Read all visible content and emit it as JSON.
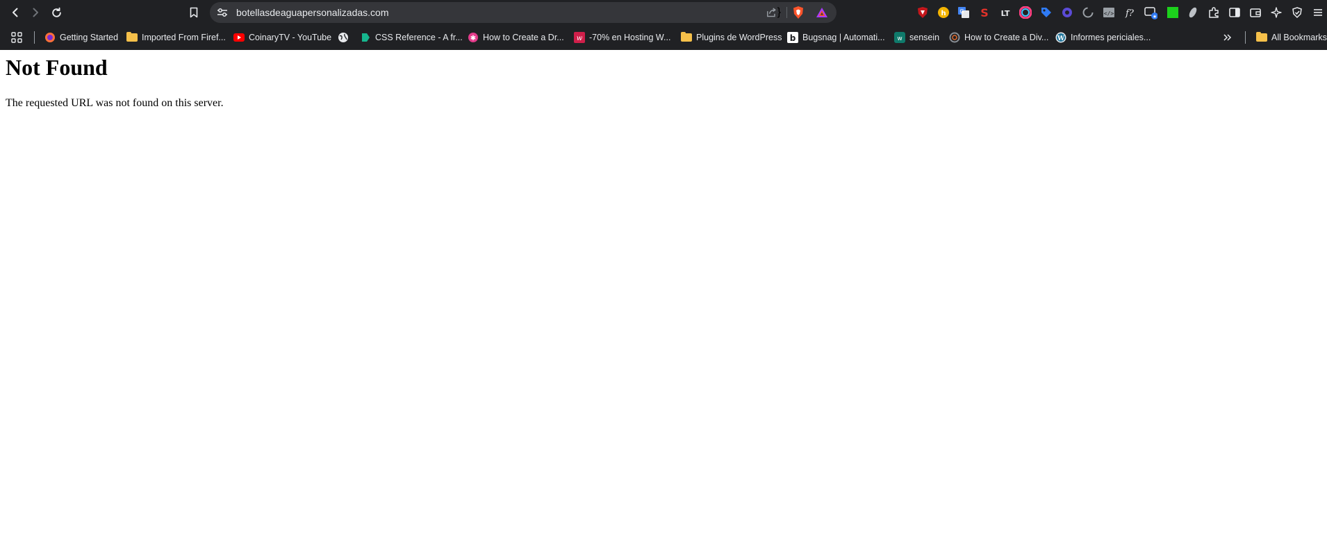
{
  "toolbar": {
    "url": "botellasdeaguapersonalizadas.com",
    "icons": {
      "back": "back-arrow-icon",
      "forward": "forward-arrow-icon",
      "reload": "reload-icon",
      "bookmark": "bookmark-icon",
      "site_info": "site-settings-icon",
      "share": "share-icon",
      "brave_shields": "brave-shields-icon",
      "brave_rewards": "brave-rewards-icon"
    }
  },
  "extensions": [
    "ublock-shield-icon",
    "honey-icon",
    "google-translate-icon",
    "speedtest-icon",
    "languagetool-icon",
    "colorzilla-icon",
    "tag-icon",
    "gear-color-icon",
    "spinner-icon",
    "code-viewer-icon",
    "font-finder-icon",
    "tab-manager-icon",
    "green-square-icon",
    "feather-icon",
    "extensions-puzzle-icon",
    "sidebar-icon",
    "wallet-icon",
    "leo-ai-icon",
    "vpn-shield-icon",
    "menu-icon"
  ],
  "bookmarks": {
    "items": [
      {
        "label": "Getting Started",
        "icon": "firefox-icon"
      },
      {
        "label": "Imported From Firef...",
        "icon": "folder-icon"
      },
      {
        "label": "CoinaryTV - YouTube",
        "icon": "youtube-icon"
      },
      {
        "label": "",
        "icon": "globe-icon"
      },
      {
        "label": "CSS Reference - A fr...",
        "icon": "codrops-icon"
      },
      {
        "label": "How to Create a Dr...",
        "icon": "flower-icon"
      },
      {
        "label": "-70% en Hosting W...",
        "icon": "webempresa-icon"
      },
      {
        "label": "Plugins de WordPress",
        "icon": "folder-icon"
      },
      {
        "label": "Bugsnag | Automati...",
        "icon": "bugsnag-icon"
      },
      {
        "label": "sensein",
        "icon": "sensein-icon"
      },
      {
        "label": "How to Create a Div...",
        "icon": "divi-icon"
      },
      {
        "label": "Informes periciales...",
        "icon": "wordpress-icon"
      }
    ],
    "all_bookmarks": "All Bookmarks"
  },
  "page": {
    "heading": "Not Found",
    "message": "The requested URL was not found on this server."
  },
  "colors": {
    "chrome_bg": "#202124",
    "omnibox_bg": "#35363a",
    "text_light": "#e8eaed",
    "brave_orange": "#fb542b",
    "page_bg": "#ffffff"
  }
}
